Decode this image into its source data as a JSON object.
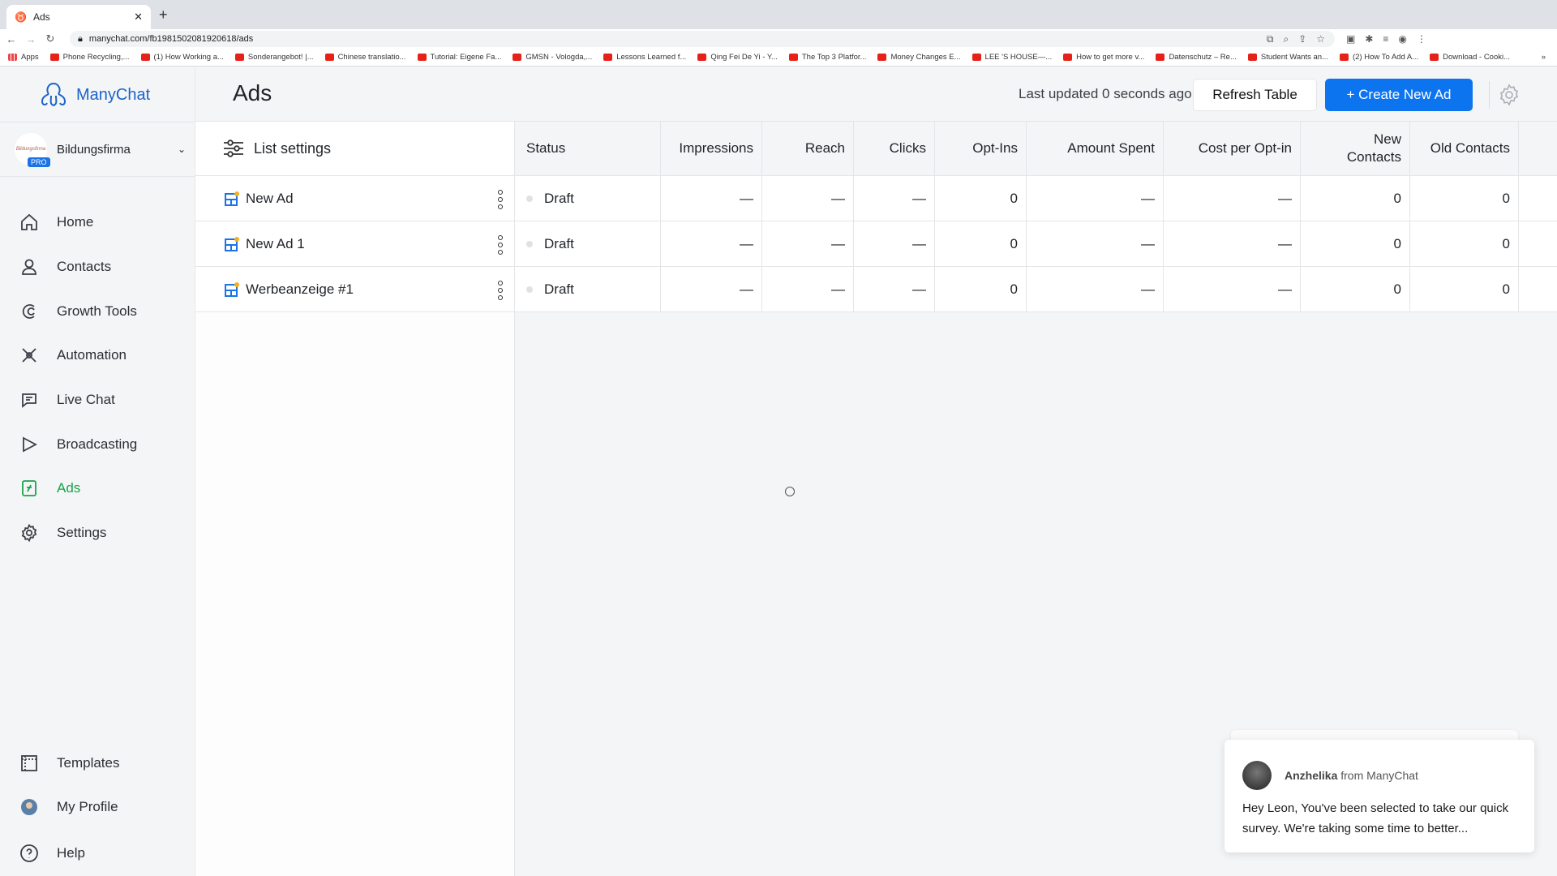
{
  "browser": {
    "tab_title": "Ads",
    "url": "manychat.com/fb198150208192061​8/ads",
    "bookmarks": [
      "Apps",
      "Phone Recycling,...",
      "(1) How Working a...",
      "Sonderangebot! |...",
      "Chinese translatio...",
      "Tutorial: Eigene Fa...",
      "GMSN - Vologda,...",
      "Lessons Learned f...",
      "Qing Fei De Yi - Y...",
      "The Top 3 Platfor...",
      "Money Changes E...",
      "LEE 'S HOUSE—...",
      "How to get more v...",
      "Datenschutz – Re...",
      "Student Wants an...",
      "(2) How To Add A...",
      "Download - Cooki..."
    ],
    "more": "»"
  },
  "sidebar": {
    "logo": "ManyChat",
    "account": {
      "name": "Bildungsfirma",
      "badge": "PRO"
    },
    "items": [
      {
        "label": "Home"
      },
      {
        "label": "Contacts"
      },
      {
        "label": "Growth Tools"
      },
      {
        "label": "Automation"
      },
      {
        "label": "Live Chat"
      },
      {
        "label": "Broadcasting"
      },
      {
        "label": "Ads"
      },
      {
        "label": "Settings"
      }
    ],
    "bottom": [
      {
        "label": "Templates"
      },
      {
        "label": "My Profile"
      },
      {
        "label": "Help"
      }
    ],
    "active": "Ads",
    "accent": "#19a34a"
  },
  "header": {
    "title": "Ads",
    "last_updated": "Last updated 0 seconds ago",
    "refresh": "Refresh Table",
    "create": "+ Create New Ad",
    "create_color": "#0d74f0"
  },
  "list": {
    "settings_label": "List settings",
    "ads": [
      "New Ad",
      "New Ad 1",
      "Werbeanzeige #1"
    ]
  },
  "table": {
    "columns": [
      "Status",
      "Impressions",
      "Reach",
      "Clicks",
      "Opt-Ins",
      "Amount Spent",
      "Cost per Opt-in",
      "New Contacts",
      "Old Contacts"
    ],
    "rows": [
      [
        "Draft",
        "—",
        "—",
        "—",
        "0",
        "—",
        "—",
        "0",
        "0"
      ],
      [
        "Draft",
        "—",
        "—",
        "—",
        "0",
        "—",
        "—",
        "0",
        "0"
      ],
      [
        "Draft",
        "—",
        "—",
        "—",
        "0",
        "—",
        "—",
        "0",
        "0"
      ]
    ]
  },
  "popup": {
    "sender": "Anzhelika",
    "from": "from ManyChat",
    "message": "Hey Leon,  You've been selected to take our quick survey. We're taking some time to better..."
  }
}
